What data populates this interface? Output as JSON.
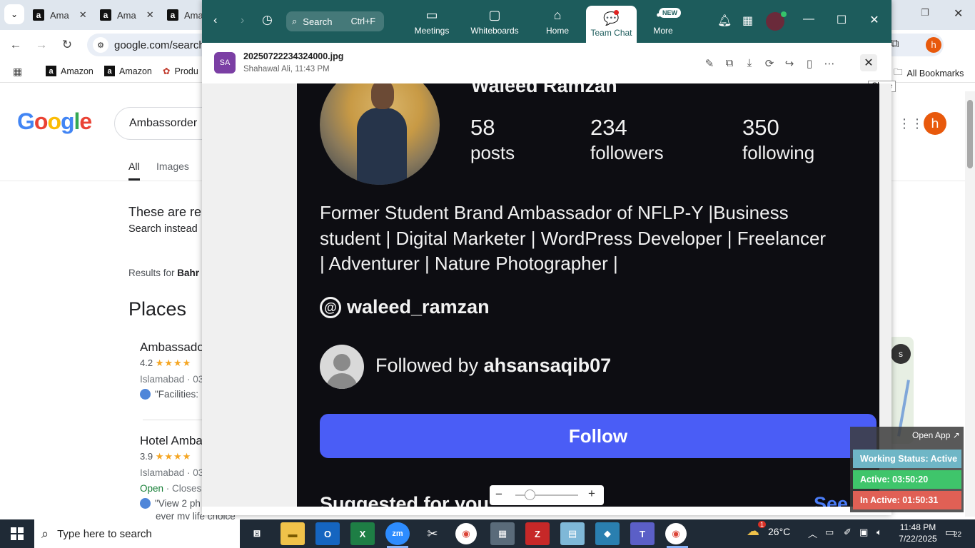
{
  "browser": {
    "tabs": [
      "Ama",
      "Ama",
      "Ama"
    ],
    "url": "google.com/search?",
    "bookmarks": [
      "Amazon",
      "Amazon",
      "Produ"
    ],
    "all_bookmarks": "All Bookmarks",
    "profile_initial": "h"
  },
  "google": {
    "logo": "Google",
    "query": "Ambassorder",
    "tabs": [
      "All",
      "Images"
    ],
    "notice_line1": "These are re",
    "notice_line2": "Search instead",
    "results_for_prefix": "Results for ",
    "results_for_bold": "Bahr",
    "places_heading": "Places",
    "places": [
      {
        "name": "Ambassado",
        "rating": "4.2",
        "stars": "★★★★",
        "location": "Islamabad · 03",
        "review": "\"Facilities:"
      },
      {
        "name": "Hotel Amba",
        "rating": "3.9",
        "stars": "★★★★",
        "location": "Islamabad · 03",
        "open": "Open",
        "closes": " · Closes",
        "review": "\"View 2 ph",
        "review2": "ever my life choice\""
      }
    ],
    "map_label": "s"
  },
  "zoom": {
    "search_label": "Search",
    "search_shortcut": "Ctrl+F",
    "nav": [
      {
        "label": "Meetings",
        "icon": "video-icon"
      },
      {
        "label": "Whiteboards",
        "icon": "whiteboard-icon"
      },
      {
        "label": "Home",
        "icon": "home-icon"
      },
      {
        "label": "Team Chat",
        "icon": "chat-icon"
      },
      {
        "label": "More",
        "icon": "more-icon"
      }
    ],
    "new_badge": "NEW",
    "file": {
      "avatar": "SA",
      "name": "20250722234324000.jpg",
      "meta": "Shahawal Ali, 11:43 PM"
    },
    "close_tooltip": "Close"
  },
  "profile": {
    "name": "Waleed Ramzan",
    "stats": [
      {
        "num": "58",
        "label": "posts"
      },
      {
        "num": "234",
        "label": "followers"
      },
      {
        "num": "350",
        "label": "following"
      }
    ],
    "bio_line1": "Former Student Brand Ambassador of NFLP-Y |Business",
    "bio_line2": "student | Digital Marketer | WordPress Developer | Freelancer",
    "bio_line3": "| Adventurer | Nature Photographer |",
    "handle": "waleed_ramzan",
    "followed_prefix": "Followed by ",
    "followed_user": "ahsansaqib07",
    "follow_button": "Follow",
    "suggested": "Suggested for you",
    "see_all": "See all"
  },
  "widget": {
    "open_app": "Open App ↗",
    "status": "Working Status: Active",
    "active": "Active: 03:50:20",
    "inactive": "In Active: 01:50:31",
    "colors": {
      "status": "#6fb6c6",
      "active": "#3fc56b",
      "inactive": "#e06055"
    }
  },
  "taskbar": {
    "search_placeholder": "Type here to search",
    "temperature": "26°C",
    "weather_badge": "1",
    "time": "11:48 PM",
    "date": "7/22/2025",
    "notifications": "22",
    "apps": [
      "task-view",
      "file-explorer",
      "outlook",
      "excel",
      "zoom",
      "snipping",
      "chrome-m",
      "calculator",
      "filezilla",
      "notepad",
      "app-blue",
      "teams",
      "chrome-h"
    ]
  }
}
